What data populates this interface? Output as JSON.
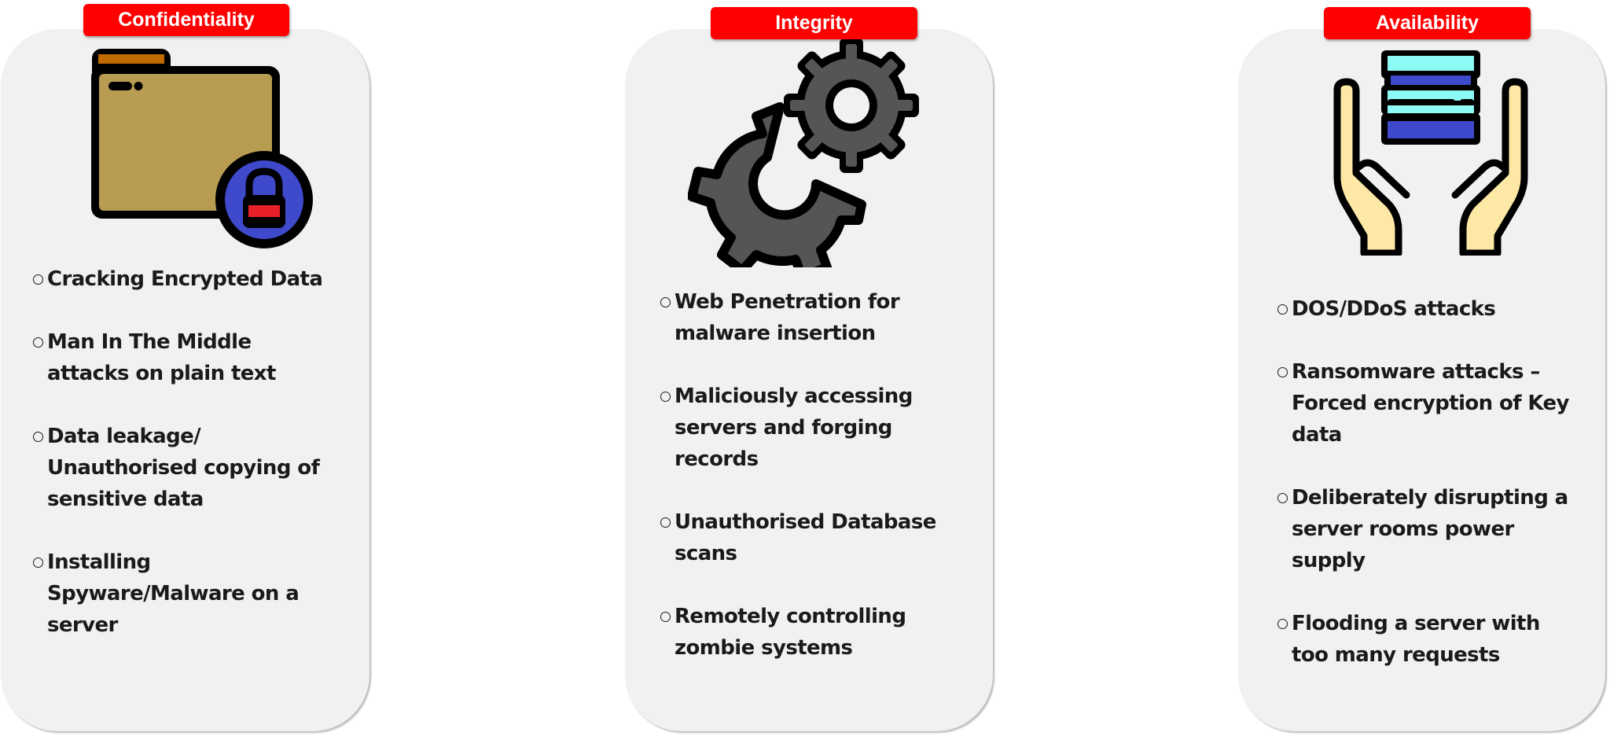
{
  "colors": {
    "label_bg": "#ff0000",
    "label_text": "#ffffff",
    "card_bg": "#f1f1f1",
    "text": "#1a1a1a",
    "folder": "#b89c52",
    "folder_tab": "#c06a00",
    "lock_circle": "#3f49cc",
    "lock_bar": "#e8202a",
    "gear": "#555555",
    "server_light": "#8cfaf5",
    "server_dark": "#3f49cc",
    "hands": "#fde8a6"
  },
  "columns": [
    {
      "title": "Confidentiality",
      "icon": "folder-lock-icon",
      "items": [
        "Cracking Encrypted Data",
        "Man In The Middle attacks on plain text",
        "Data leakage/ Unauthorised copying of sensitive data",
        "Installing Spyware/Malware on a server"
      ]
    },
    {
      "title": "Integrity",
      "icon": "gears-icon",
      "items": [
        "Web Penetration for malware insertion",
        "Maliciously accessing servers and forging records",
        "Unauthorised Database scans",
        "Remotely controlling zombie systems"
      ]
    },
    {
      "title": "Availability",
      "icon": "hands-server-icon",
      "items": [
        "DOS/DDoS attacks",
        "Ransomware attacks – Forced encryption of Key data",
        "Deliberately disrupting a server rooms power supply",
        "Flooding a server with too many requests"
      ]
    }
  ]
}
